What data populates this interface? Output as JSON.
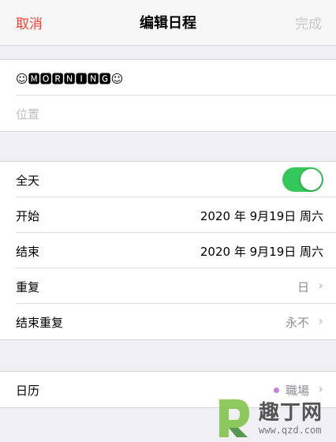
{
  "nav": {
    "cancel": "取消",
    "title": "编辑日程",
    "done": "完成"
  },
  "event": {
    "title": "☺🅼🅾🆁🅽🅸🅽🅶☺",
    "location_placeholder": "位置"
  },
  "time": {
    "all_day_label": "全天",
    "all_day_on": true,
    "start_label": "开始",
    "start_value": "2020 年 9月19日 周六",
    "end_label": "结束",
    "end_value": "2020 年 9月19日 周六"
  },
  "repeat": {
    "repeat_label": "重复",
    "repeat_value": "日",
    "end_repeat_label": "结束重复",
    "end_repeat_value": "永不"
  },
  "calendar": {
    "label": "日历",
    "value": "職場",
    "color": "#c77fe0"
  },
  "watermark": {
    "text": "趣丁网",
    "url": "www.qzd.com"
  },
  "colors": {
    "accent": "#ff3b30",
    "toggle_on": "#34c759",
    "disabled": "#c7c7cc"
  }
}
